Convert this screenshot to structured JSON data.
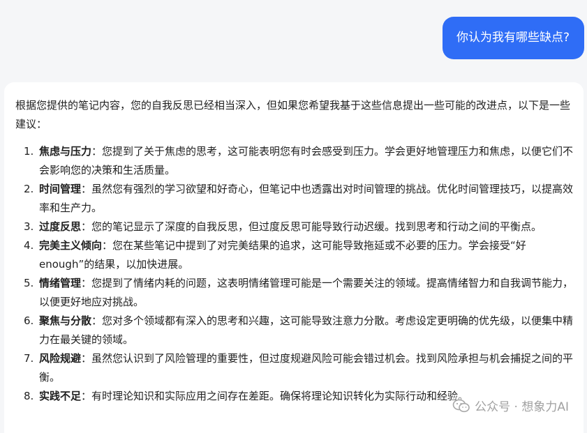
{
  "user_message": "你认为我有哪些缺点?",
  "response": {
    "intro": "根据您提供的笔记内容，您的自我反思已经相当深入，但如果您希望我基于这些信息提出一些可能的改进点，以下是一些建议：",
    "items": [
      {
        "num": "1.",
        "term": "焦虑与压力",
        "text": "：您提到了关于焦虑的思考，这可能表明您有时会感受到压力。学会更好地管理压力和焦虑，以便它们不会影响您的决策和生活质量。"
      },
      {
        "num": "2.",
        "term": "时间管理",
        "text": "：虽然您有强烈的学习欲望和好奇心，但笔记中也透露出对时间管理的挑战。优化时间管理技巧，以提高效率和生产力。"
      },
      {
        "num": "3.",
        "term": "过度反思",
        "text": "：您的笔记显示了深度的自我反思，但过度反思可能导致行动迟缓。找到思考和行动之间的平衡点。"
      },
      {
        "num": "4.",
        "term": "完美主义倾向",
        "text": "：您在某些笔记中提到了对完美结果的追求，这可能导致拖延或不必要的压力。学会接受“好 enough”的结果，以加快进展。"
      },
      {
        "num": "5.",
        "term": "情绪管理",
        "text": "：您提到了情绪内耗的问题，这表明情绪管理可能是一个需要关注的领域。提高情绪智力和自我调节能力，以便更好地应对挑战。"
      },
      {
        "num": "6.",
        "term": "聚焦与分散",
        "text": "：您对多个领域都有深入的思考和兴趣，这可能导致注意力分散。考虑设定更明确的优先级，以便集中精力在最关键的领域。"
      },
      {
        "num": "7.",
        "term": "风险规避",
        "text": "：虽然您认识到了风险管理的重要性，但过度规避风险可能会错过机会。找到风险承担与机会捕捉之间的平衡。"
      },
      {
        "num": "8.",
        "term": "实践不足",
        "text": "：有时理论知识和实际应用之间存在差距。确保将理论知识转化为实际行动和经验。"
      }
    ]
  },
  "watermark": {
    "text": "公众号 · 想象力AI",
    "icon": "wechat-icon"
  }
}
